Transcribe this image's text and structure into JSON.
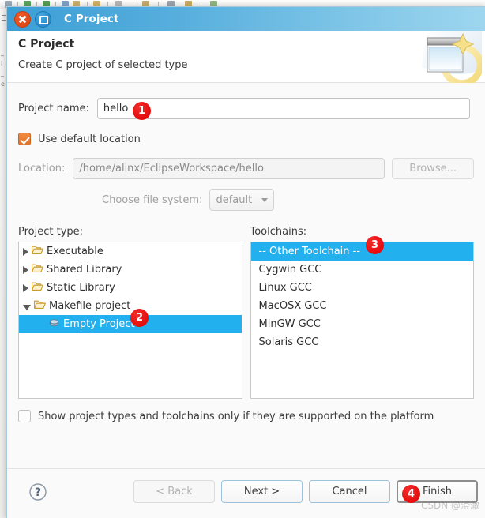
{
  "window": {
    "title": "C Project",
    "close_icon": "close-icon",
    "maximize_icon": "maximize-icon"
  },
  "header": {
    "title": "C Project",
    "subtitle": "Create C project of selected type",
    "banner_icon": "wizard-banner-icon"
  },
  "form": {
    "project_name_label": "Project name:",
    "project_name_value": "hello",
    "project_name_placeholder": "",
    "use_default_location_label": "Use default location",
    "use_default_location_checked": true,
    "location_label": "Location:",
    "location_value": "/home/alinx/EclipseWorkspace/hello",
    "browse_label": "Browse...",
    "file_system_label": "Choose file system:",
    "file_system_value": "default",
    "file_system_options": [
      "default"
    ]
  },
  "project_type": {
    "label": "Project type:",
    "items": [
      {
        "label": "Executable",
        "expanded": false,
        "selected": false,
        "depth": 0,
        "icon": "folder-icon"
      },
      {
        "label": "Shared Library",
        "expanded": false,
        "selected": false,
        "depth": 0,
        "icon": "folder-icon"
      },
      {
        "label": "Static Library",
        "expanded": false,
        "selected": false,
        "depth": 0,
        "icon": "folder-icon"
      },
      {
        "label": "Makefile project",
        "expanded": true,
        "selected": false,
        "depth": 0,
        "icon": "folder-icon"
      },
      {
        "label": "Empty Project",
        "expanded": null,
        "selected": true,
        "depth": 1,
        "icon": "project-leaf-icon"
      }
    ]
  },
  "toolchains": {
    "label": "Toolchains:",
    "items": [
      {
        "label": "-- Other Toolchain --",
        "selected": true
      },
      {
        "label": "Cygwin GCC",
        "selected": false
      },
      {
        "label": "Linux GCC",
        "selected": false
      },
      {
        "label": "MacOSX GCC",
        "selected": false
      },
      {
        "label": "MinGW GCC",
        "selected": false
      },
      {
        "label": "Solaris GCC",
        "selected": false
      }
    ]
  },
  "options": {
    "show_supported_label": "Show project types and toolchains only if they are supported on the platform",
    "show_supported_checked": false
  },
  "footer": {
    "help_icon": "help-icon",
    "back_label": "< Back",
    "back_disabled": true,
    "next_label": "Next >",
    "cancel_label": "Cancel",
    "finish_label": "Finish"
  },
  "annotations": {
    "badges": [
      {
        "number": "1",
        "target": "project-name-input"
      },
      {
        "number": "2",
        "target": "project-type-empty-project"
      },
      {
        "number": "3",
        "target": "toolchain-other"
      },
      {
        "number": "4",
        "target": "finish-button"
      }
    ]
  },
  "watermark": {
    "text": "CSDN @澄澈"
  },
  "colors": {
    "titlebar_start": "#3c9ed6",
    "titlebar_end": "#9ed6ef",
    "selection": "#22b0ef",
    "checkbox_on": "#e2732b",
    "badge": "#e00000",
    "close_button": "#dc4410",
    "maximize_button": "#1d82c4"
  }
}
